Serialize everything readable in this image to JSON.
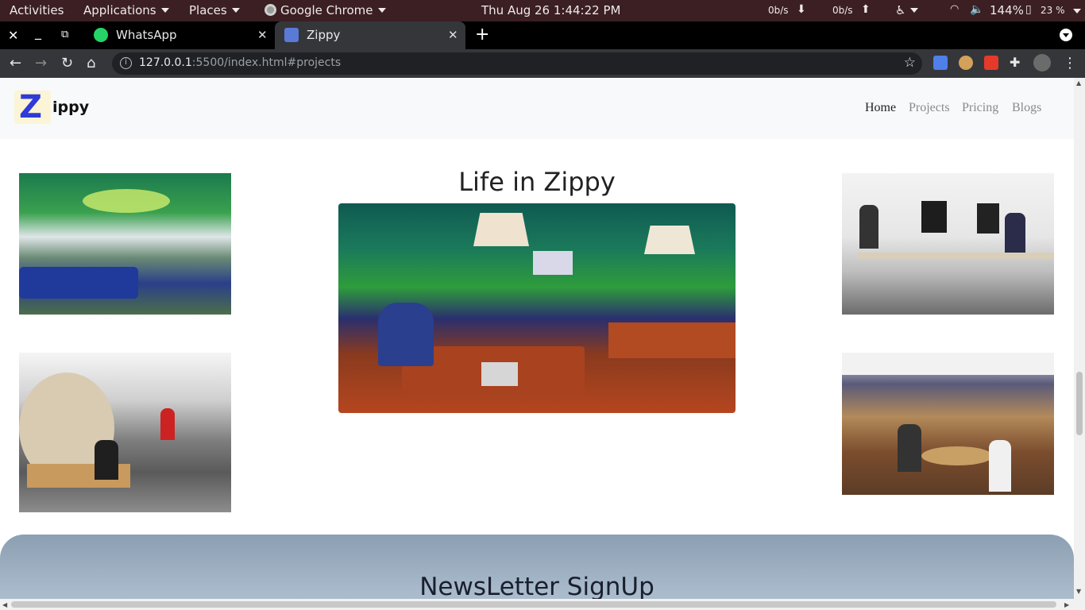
{
  "system_bar": {
    "activities": "Activities",
    "applications": "Applications",
    "places": "Places",
    "browser_menu": "Google Chrome",
    "clock": "Thu Aug 26   1:44:22 PM",
    "net_down": "0b/s",
    "net_up": "0b/s",
    "volume": "144%",
    "battery": "23 %"
  },
  "tabs": [
    {
      "title": "WhatsApp",
      "icon": "whatsapp-icon",
      "active": false
    },
    {
      "title": "Zippy",
      "icon": "zippy-favicon",
      "active": true
    }
  ],
  "address_bar": {
    "host": "127.0.0.1",
    "path": ":5500/index.html#projects"
  },
  "navbar": {
    "logo_letter": "Z",
    "brand": "ippy",
    "links": [
      "Home",
      "Projects",
      "Pricing",
      "Blogs"
    ],
    "active_link": "Home"
  },
  "gallery": {
    "title": "Life in Zippy",
    "photos": [
      "office-lounge-photo",
      "workstation-photo",
      "wooden-pod-photo",
      "main-office-photo",
      "cafeteria-photo"
    ]
  },
  "newsletter": {
    "title": "NewsLetter SignUp"
  },
  "colors": {
    "system_bar": "#3b1f22",
    "chrome_toolbar": "#35363a",
    "navbar": "#f8f9fa",
    "brand_blue": "#2f3ad8"
  }
}
